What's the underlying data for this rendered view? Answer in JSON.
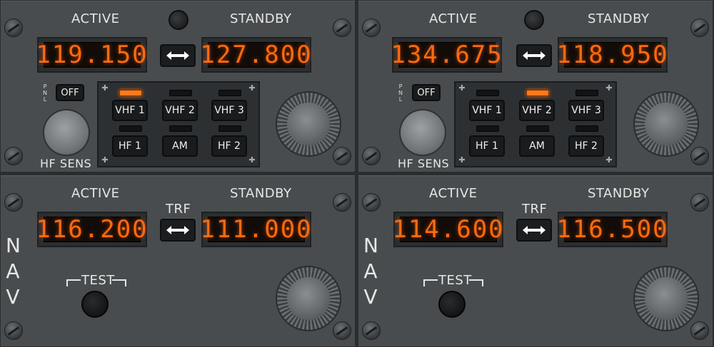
{
  "colors": {
    "panel": "#484c4f",
    "display_digits": "#ff6a10",
    "lamp_on": "#ff7a1c"
  },
  "rmp": [
    {
      "active_label": "ACTIVE",
      "standby_label": "STANDBY",
      "active_freq": "119.150",
      "standby_freq": "127.800",
      "swap_icon": "swap-arrows-icon",
      "pnl_letters": [
        "P",
        "N",
        "L"
      ],
      "off_label": "OFF",
      "hf_sens_label": "HF SENS",
      "buttons": [
        "VHF 1",
        "VHF 2",
        "VHF 3",
        "HF 1",
        "AM",
        "HF 2"
      ],
      "selected": "VHF 1"
    },
    {
      "active_label": "ACTIVE",
      "standby_label": "STANDBY",
      "active_freq": "134.675",
      "standby_freq": "118.950",
      "swap_icon": "swap-arrows-icon",
      "pnl_letters": [
        "P",
        "N",
        "L"
      ],
      "off_label": "OFF",
      "hf_sens_label": "HF SENS",
      "buttons": [
        "VHF 1",
        "VHF 2",
        "VHF 3",
        "HF 1",
        "AM",
        "HF 2"
      ],
      "selected": "VHF 2"
    }
  ],
  "nav": [
    {
      "active_label": "ACTIVE",
      "standby_label": "STANDBY",
      "trf_label": "TRF",
      "active_freq": "116.200",
      "standby_freq": "111.000",
      "side_letters": [
        "N",
        "A",
        "V"
      ],
      "test_label": "TEST"
    },
    {
      "active_label": "ACTIVE",
      "standby_label": "STANDBY",
      "trf_label": "TRF",
      "active_freq": "114.600",
      "standby_freq": "116.500",
      "side_letters": [
        "N",
        "A",
        "V"
      ],
      "test_label": "TEST"
    }
  ]
}
